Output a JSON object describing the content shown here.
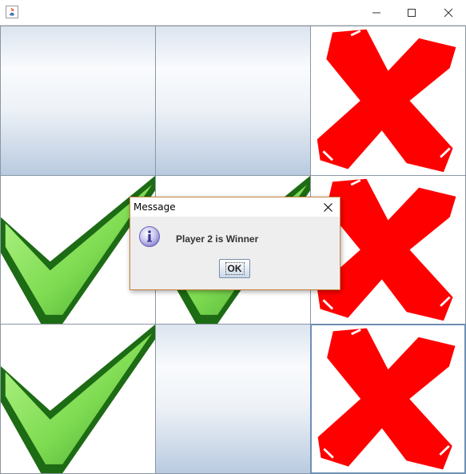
{
  "window": {
    "title": "",
    "controls": [
      "minimize",
      "maximize",
      "close"
    ]
  },
  "board": {
    "cells": [
      {
        "mark": "empty"
      },
      {
        "mark": "empty"
      },
      {
        "mark": "cross"
      },
      {
        "mark": "check"
      },
      {
        "mark": "check"
      },
      {
        "mark": "cross"
      },
      {
        "mark": "check"
      },
      {
        "mark": "empty"
      },
      {
        "mark": "cross"
      }
    ]
  },
  "dialog": {
    "title": "Message",
    "message": "Player 2 is Winner",
    "ok_label": "OK",
    "icon": "info-icon"
  },
  "colors": {
    "cross": "#ff0000",
    "check_light": "#7fdc52",
    "check_dark": "#1d6b14",
    "dialog_border": "#c6843f"
  }
}
